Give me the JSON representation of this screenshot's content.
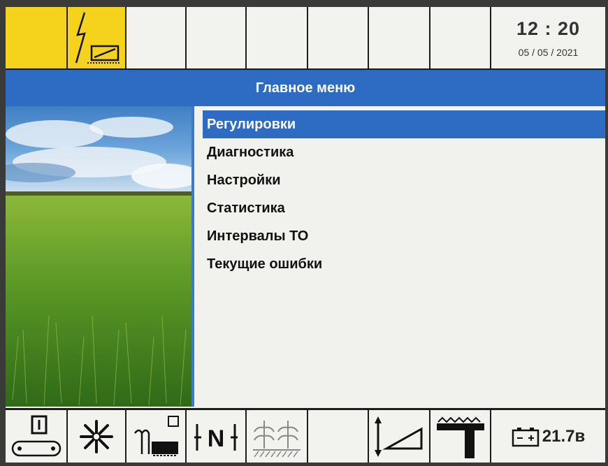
{
  "status": {
    "time": "12 : 20",
    "date": "05 / 05 / 2021"
  },
  "header": {
    "title": "Главное меню"
  },
  "menu": {
    "items": [
      {
        "label": "Регулировки",
        "selected": true
      },
      {
        "label": "Диагностика"
      },
      {
        "label": "Настройки"
      },
      {
        "label": "Статистика"
      },
      {
        "label": "Интервалы ТО"
      },
      {
        "label": "Текущие ошибки"
      }
    ]
  },
  "toolbar": {
    "icons": [
      "conveyor-lock-icon",
      "fan-icon",
      "cutter-bar-icon",
      "center-lock-icon",
      "crop-icon",
      "empty",
      "header-height-icon",
      "header-tilt-icon",
      "battery-icon"
    ],
    "battery_voltage": "21.7в"
  },
  "colors": {
    "accent": "#2e6bc3",
    "active_tab": "#f5d31c",
    "background": "#f1f1ee"
  }
}
